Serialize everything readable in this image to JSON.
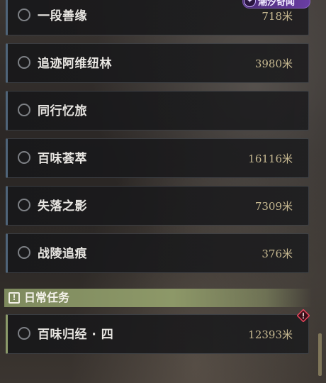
{
  "badge": {
    "text": "潮汐奇闻"
  },
  "quests": [
    {
      "title": "一段善缘",
      "distance": "718米"
    },
    {
      "title": "追迹阿维纽林",
      "distance": "3980米"
    },
    {
      "title": "同行忆旅",
      "distance": ""
    },
    {
      "title": "百味荟萃",
      "distance": "16116米"
    },
    {
      "title": "失落之影",
      "distance": "7309米"
    },
    {
      "title": "战陵追痕",
      "distance": "376米"
    }
  ],
  "daily_section": {
    "label": "日常任务",
    "quests": [
      {
        "title": "百味归经 · 四",
        "distance": "12393米"
      }
    ]
  },
  "colors": {
    "main_quest_accent": "#4f6479",
    "daily_accent": "#8b9a6a",
    "distance_text": "#c7b991",
    "alert": "#e0445a",
    "badge_purple": "#6a3ea4"
  },
  "icons": {
    "section": "exclamation-box-icon",
    "alert": "diamond-alert-icon",
    "radio": "radio-circle-icon"
  }
}
